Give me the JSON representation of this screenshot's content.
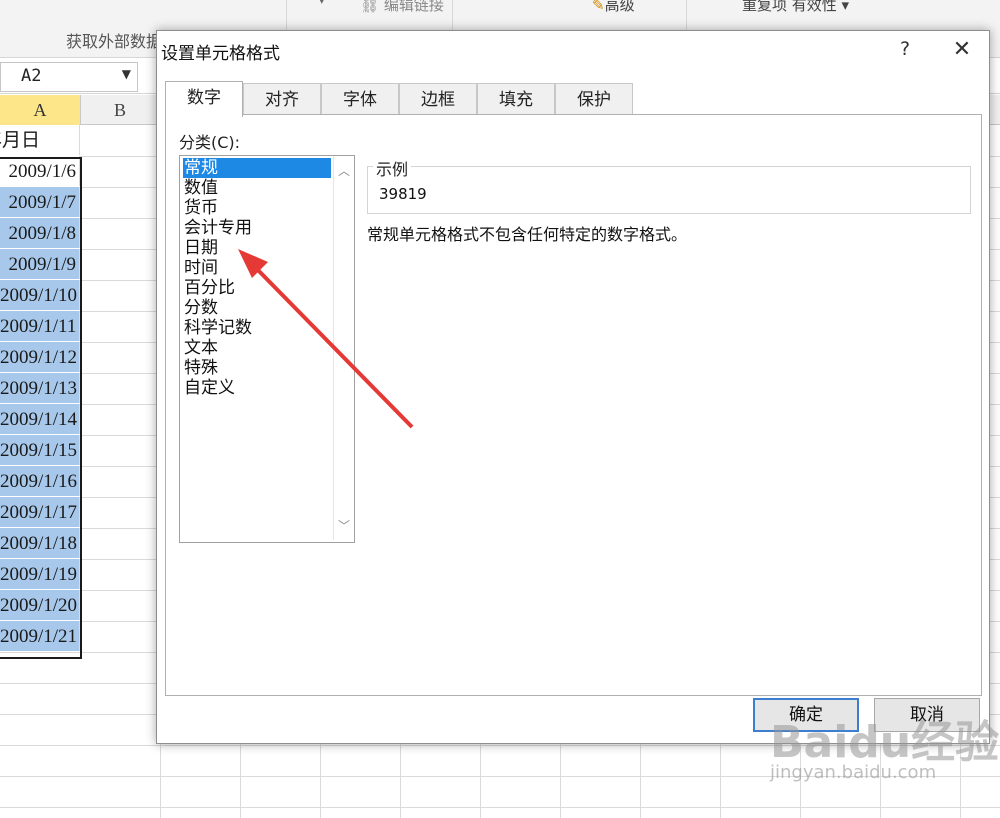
{
  "ribbon": {
    "edit_links": "编辑链接",
    "advanced": "高级",
    "dedupe_validate": "重复项 有效性",
    "get_external_data": "获取外部数据"
  },
  "name_box": {
    "value": "A2"
  },
  "columns": [
    "A",
    "B"
  ],
  "sheet": {
    "header_cell": "年月日",
    "dates": [
      "2009/1/6",
      "2009/1/7",
      "2009/1/8",
      "2009/1/9",
      "2009/1/10",
      "2009/1/11",
      "2009/1/12",
      "2009/1/13",
      "2009/1/14",
      "2009/1/15",
      "2009/1/16",
      "2009/1/17",
      "2009/1/18",
      "2009/1/19",
      "2009/1/20",
      "2009/1/21"
    ]
  },
  "dialog": {
    "title": "设置单元格格式",
    "help": "?",
    "close": "✕",
    "tabs": [
      "数字",
      "对齐",
      "字体",
      "边框",
      "填充",
      "保护"
    ],
    "active_tab": "数字",
    "category_label": "分类(C):",
    "categories": [
      "常规",
      "数值",
      "货币",
      "会计专用",
      "日期",
      "时间",
      "百分比",
      "分数",
      "科学记数",
      "文本",
      "特殊",
      "自定义"
    ],
    "selected_category": "常规",
    "sample_label": "示例",
    "sample_value": "39819",
    "description": "常规单元格格式不包含任何特定的数字格式。",
    "ok": "确定",
    "cancel": "取消"
  },
  "annotation": {
    "arrow_color": "#e53935"
  },
  "watermark": {
    "brand": "Baidu经验",
    "sub": "jingyan.baidu.com"
  }
}
